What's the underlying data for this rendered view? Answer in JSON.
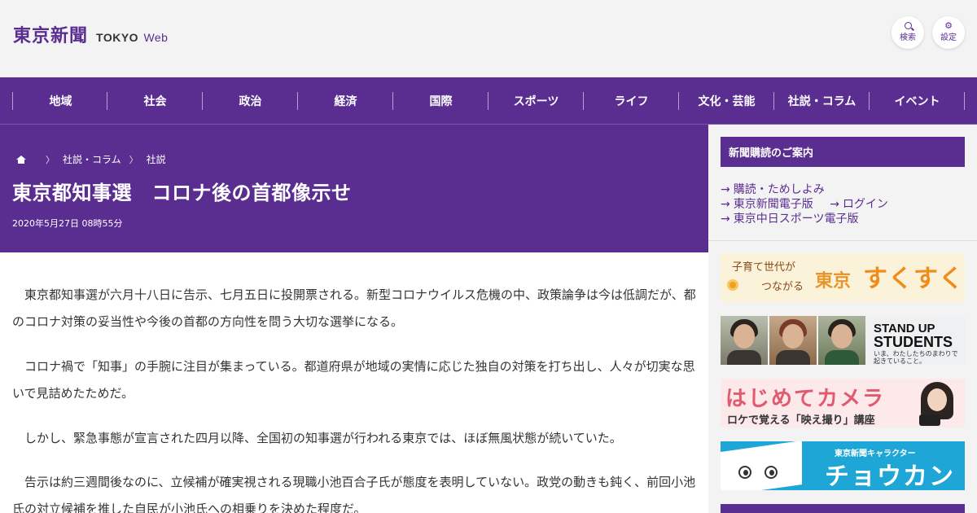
{
  "header": {
    "logo_jp": "東京新聞",
    "logo_en": "TOKYO",
    "logo_web": "Web",
    "search_label": "検索",
    "settings_label": "設定"
  },
  "nav": {
    "items": [
      "地域",
      "社会",
      "政治",
      "経済",
      "国際",
      "スポーツ",
      "ライフ",
      "文化・芸能",
      "社説・コラム",
      "イベント"
    ]
  },
  "article": {
    "breadcrumbs": [
      "社説・コラム",
      "社説"
    ],
    "title": "東京都知事選　コロナ後の首都像示せ",
    "date": "2020年5月27日 08時55分",
    "paragraphs": [
      "東京都知事選が六月十八日に告示、七月五日に投開票される。新型コロナウイルス危機の中、政策論争は今は低調だが、都のコロナ対策の妥当性や今後の首都の方向性を問う大切な選挙になる。",
      "コロナ禍で「知事」の手腕に注目が集まっている。都道府県が地域の実情に応じた独自の対策を打ち出し、人々が切実な思いで見詰めたためだ。",
      "しかし、緊急事態が宣言された四月以降、全国初の知事選が行われる東京では、ほぼ無風状態が続いていた。",
      "告示は約三週間後なのに、立候補が確実視される現職小池百合子氏が態度を表明していない。政党の動きも鈍く、前回小池氏の対立候補を推した自民が小池氏への相乗りを決めた程度だ。"
    ]
  },
  "sidebar": {
    "subscribe_title": "新聞購読のご案内",
    "links": {
      "trial": "購読・ためしよみ",
      "digital": "東京新聞電子版",
      "login": "ログイン",
      "sports": "東京中日スポーツ電子版"
    },
    "banners": {
      "sukusuku": {
        "line1": "子育て世代が",
        "line2": "つながる",
        "city": "東京",
        "main": "すくすく"
      },
      "standup": {
        "line1": "STAND UP",
        "line2": "STUDENTS",
        "sub1": "いま、わたしたちのまわりで",
        "sub2": "起きていること。"
      },
      "camera": {
        "main": "はじめてカメラ",
        "sub": "ロケで覚える「映え撮り」講座"
      },
      "character": {
        "top": "東京新聞キャラクター",
        "main": "チョウカンヌ"
      }
    }
  },
  "colors": {
    "brand_purple": "#5a2d91",
    "background": "#f3f3f3"
  },
  "icons": [
    "search-icon",
    "gear-icon",
    "home-icon",
    "arrow-right-icon"
  ]
}
